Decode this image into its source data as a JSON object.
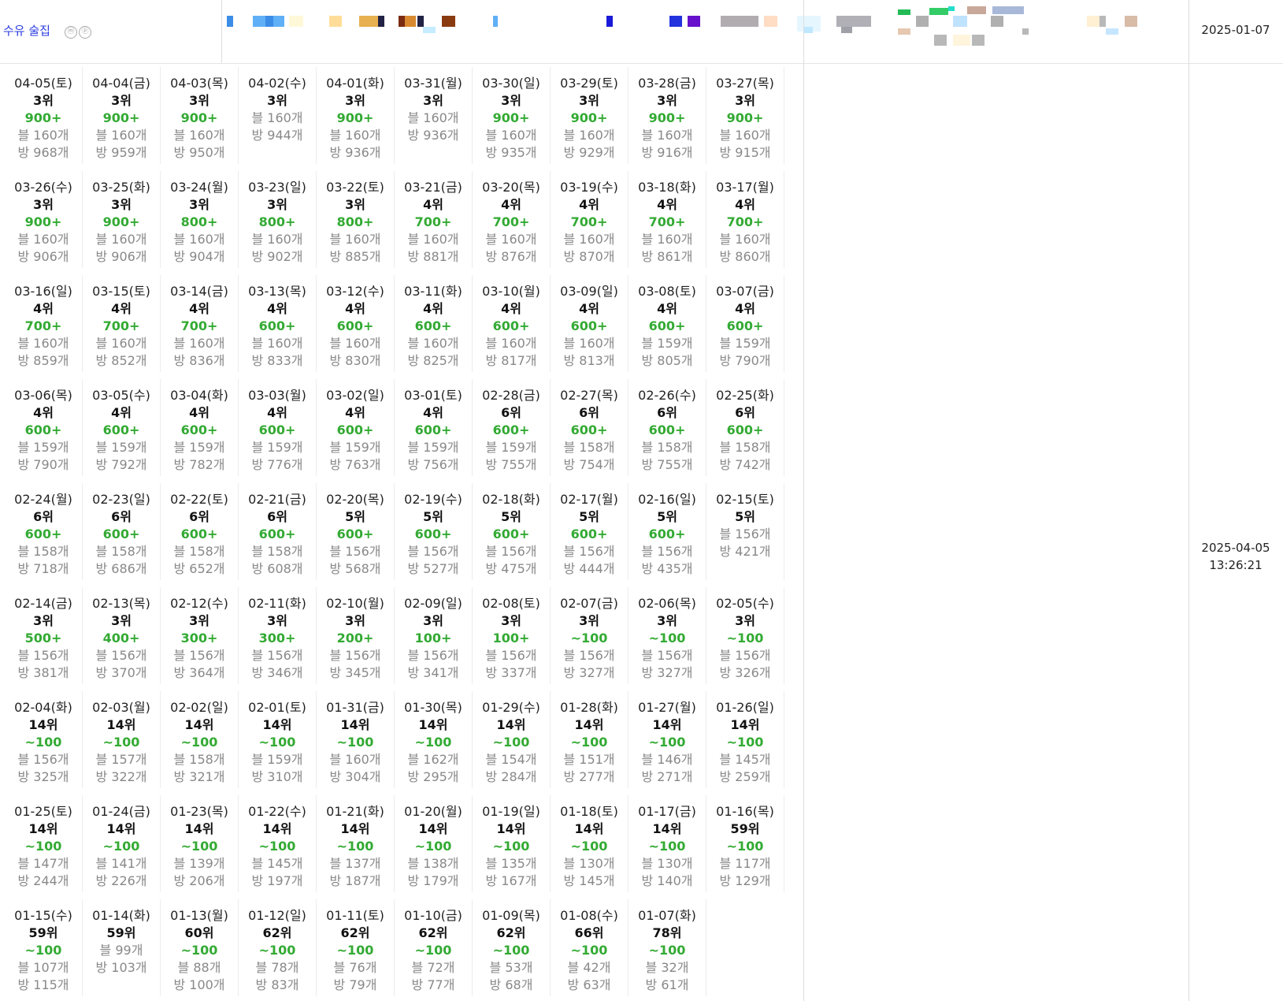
{
  "header": {
    "keyword": "수유 술집",
    "icons": [
      "ⓜ",
      "ⓟ"
    ],
    "start_date": "2025-01-07"
  },
  "updated": {
    "date": "2025-04-05",
    "time": "13:26:21"
  },
  "entries": [
    {
      "d": "04-05(토)",
      "r": "3위",
      "g": "900+",
      "b": "블 160개",
      "m": "방 968개"
    },
    {
      "d": "04-04(금)",
      "r": "3위",
      "g": "900+",
      "b": "블 160개",
      "m": "방 959개"
    },
    {
      "d": "04-03(목)",
      "r": "3위",
      "g": "900+",
      "b": "블 160개",
      "m": "방 950개"
    },
    {
      "d": "04-02(수)",
      "r": "3위",
      "g": "",
      "b": "블 160개",
      "m": "방 944개"
    },
    {
      "d": "04-01(화)",
      "r": "3위",
      "g": "900+",
      "b": "블 160개",
      "m": "방 936개"
    },
    {
      "d": "03-31(월)",
      "r": "3위",
      "g": "",
      "b": "블 160개",
      "m": "방 936개"
    },
    {
      "d": "03-30(일)",
      "r": "3위",
      "g": "900+",
      "b": "블 160개",
      "m": "방 935개"
    },
    {
      "d": "03-29(토)",
      "r": "3위",
      "g": "900+",
      "b": "블 160개",
      "m": "방 929개"
    },
    {
      "d": "03-28(금)",
      "r": "3위",
      "g": "900+",
      "b": "블 160개",
      "m": "방 916개"
    },
    {
      "d": "03-27(목)",
      "r": "3위",
      "g": "900+",
      "b": "블 160개",
      "m": "방 915개"
    },
    {
      "d": "03-26(수)",
      "r": "3위",
      "g": "900+",
      "b": "블 160개",
      "m": "방 906개"
    },
    {
      "d": "03-25(화)",
      "r": "3위",
      "g": "900+",
      "b": "블 160개",
      "m": "방 906개"
    },
    {
      "d": "03-24(월)",
      "r": "3위",
      "g": "800+",
      "b": "블 160개",
      "m": "방 904개"
    },
    {
      "d": "03-23(일)",
      "r": "3위",
      "g": "800+",
      "b": "블 160개",
      "m": "방 902개"
    },
    {
      "d": "03-22(토)",
      "r": "3위",
      "g": "800+",
      "b": "블 160개",
      "m": "방 885개"
    },
    {
      "d": "03-21(금)",
      "r": "4위",
      "g": "700+",
      "b": "블 160개",
      "m": "방 881개"
    },
    {
      "d": "03-20(목)",
      "r": "4위",
      "g": "700+",
      "b": "블 160개",
      "m": "방 876개"
    },
    {
      "d": "03-19(수)",
      "r": "4위",
      "g": "700+",
      "b": "블 160개",
      "m": "방 870개"
    },
    {
      "d": "03-18(화)",
      "r": "4위",
      "g": "700+",
      "b": "블 160개",
      "m": "방 861개"
    },
    {
      "d": "03-17(월)",
      "r": "4위",
      "g": "700+",
      "b": "블 160개",
      "m": "방 860개"
    },
    {
      "d": "03-16(일)",
      "r": "4위",
      "g": "700+",
      "b": "블 160개",
      "m": "방 859개"
    },
    {
      "d": "03-15(토)",
      "r": "4위",
      "g": "700+",
      "b": "블 160개",
      "m": "방 852개"
    },
    {
      "d": "03-14(금)",
      "r": "4위",
      "g": "700+",
      "b": "블 160개",
      "m": "방 836개"
    },
    {
      "d": "03-13(목)",
      "r": "4위",
      "g": "600+",
      "b": "블 160개",
      "m": "방 833개"
    },
    {
      "d": "03-12(수)",
      "r": "4위",
      "g": "600+",
      "b": "블 160개",
      "m": "방 830개"
    },
    {
      "d": "03-11(화)",
      "r": "4위",
      "g": "600+",
      "b": "블 160개",
      "m": "방 825개"
    },
    {
      "d": "03-10(월)",
      "r": "4위",
      "g": "600+",
      "b": "블 160개",
      "m": "방 817개"
    },
    {
      "d": "03-09(일)",
      "r": "4위",
      "g": "600+",
      "b": "블 160개",
      "m": "방 813개"
    },
    {
      "d": "03-08(토)",
      "r": "4위",
      "g": "600+",
      "b": "블 159개",
      "m": "방 805개"
    },
    {
      "d": "03-07(금)",
      "r": "4위",
      "g": "600+",
      "b": "블 159개",
      "m": "방 790개"
    },
    {
      "d": "03-06(목)",
      "r": "4위",
      "g": "600+",
      "b": "블 159개",
      "m": "방 790개"
    },
    {
      "d": "03-05(수)",
      "r": "4위",
      "g": "600+",
      "b": "블 159개",
      "m": "방 792개"
    },
    {
      "d": "03-04(화)",
      "r": "4위",
      "g": "600+",
      "b": "블 159개",
      "m": "방 782개"
    },
    {
      "d": "03-03(월)",
      "r": "4위",
      "g": "600+",
      "b": "블 159개",
      "m": "방 776개"
    },
    {
      "d": "03-02(일)",
      "r": "4위",
      "g": "600+",
      "b": "블 159개",
      "m": "방 763개"
    },
    {
      "d": "03-01(토)",
      "r": "4위",
      "g": "600+",
      "b": "블 159개",
      "m": "방 756개"
    },
    {
      "d": "02-28(금)",
      "r": "6위",
      "g": "600+",
      "b": "블 159개",
      "m": "방 755개"
    },
    {
      "d": "02-27(목)",
      "r": "6위",
      "g": "600+",
      "b": "블 158개",
      "m": "방 754개"
    },
    {
      "d": "02-26(수)",
      "r": "6위",
      "g": "600+",
      "b": "블 158개",
      "m": "방 755개"
    },
    {
      "d": "02-25(화)",
      "r": "6위",
      "g": "600+",
      "b": "블 158개",
      "m": "방 742개"
    },
    {
      "d": "02-24(월)",
      "r": "6위",
      "g": "600+",
      "b": "블 158개",
      "m": "방 718개"
    },
    {
      "d": "02-23(일)",
      "r": "6위",
      "g": "600+",
      "b": "블 158개",
      "m": "방 686개"
    },
    {
      "d": "02-22(토)",
      "r": "6위",
      "g": "600+",
      "b": "블 158개",
      "m": "방 652개"
    },
    {
      "d": "02-21(금)",
      "r": "6위",
      "g": "600+",
      "b": "블 158개",
      "m": "방 608개"
    },
    {
      "d": "02-20(목)",
      "r": "5위",
      "g": "600+",
      "b": "블 156개",
      "m": "방 568개"
    },
    {
      "d": "02-19(수)",
      "r": "5위",
      "g": "600+",
      "b": "블 156개",
      "m": "방 527개"
    },
    {
      "d": "02-18(화)",
      "r": "5위",
      "g": "600+",
      "b": "블 156개",
      "m": "방 475개"
    },
    {
      "d": "02-17(월)",
      "r": "5위",
      "g": "600+",
      "b": "블 156개",
      "m": "방 444개"
    },
    {
      "d": "02-16(일)",
      "r": "5위",
      "g": "600+",
      "b": "블 156개",
      "m": "방 435개"
    },
    {
      "d": "02-15(토)",
      "r": "5위",
      "g": "",
      "b": "블 156개",
      "m": "방 421개"
    },
    {
      "d": "02-14(금)",
      "r": "3위",
      "g": "500+",
      "b": "블 156개",
      "m": "방 381개"
    },
    {
      "d": "02-13(목)",
      "r": "3위",
      "g": "400+",
      "b": "블 156개",
      "m": "방 370개"
    },
    {
      "d": "02-12(수)",
      "r": "3위",
      "g": "300+",
      "b": "블 156개",
      "m": "방 364개"
    },
    {
      "d": "02-11(화)",
      "r": "3위",
      "g": "300+",
      "b": "블 156개",
      "m": "방 346개"
    },
    {
      "d": "02-10(월)",
      "r": "3위",
      "g": "200+",
      "b": "블 156개",
      "m": "방 345개"
    },
    {
      "d": "02-09(일)",
      "r": "3위",
      "g": "100+",
      "b": "블 156개",
      "m": "방 341개"
    },
    {
      "d": "02-08(토)",
      "r": "3위",
      "g": "100+",
      "b": "블 156개",
      "m": "방 337개"
    },
    {
      "d": "02-07(금)",
      "r": "3위",
      "g": "~100",
      "b": "블 156개",
      "m": "방 327개"
    },
    {
      "d": "02-06(목)",
      "r": "3위",
      "g": "~100",
      "b": "블 156개",
      "m": "방 327개"
    },
    {
      "d": "02-05(수)",
      "r": "3위",
      "g": "~100",
      "b": "블 156개",
      "m": "방 326개"
    },
    {
      "d": "02-04(화)",
      "r": "14위",
      "g": "~100",
      "b": "블 156개",
      "m": "방 325개"
    },
    {
      "d": "02-03(월)",
      "r": "14위",
      "g": "~100",
      "b": "블 157개",
      "m": "방 322개"
    },
    {
      "d": "02-02(일)",
      "r": "14위",
      "g": "~100",
      "b": "블 158개",
      "m": "방 321개"
    },
    {
      "d": "02-01(토)",
      "r": "14위",
      "g": "~100",
      "b": "블 159개",
      "m": "방 310개"
    },
    {
      "d": "01-31(금)",
      "r": "14위",
      "g": "~100",
      "b": "블 160개",
      "m": "방 304개"
    },
    {
      "d": "01-30(목)",
      "r": "14위",
      "g": "~100",
      "b": "블 162개",
      "m": "방 295개"
    },
    {
      "d": "01-29(수)",
      "r": "14위",
      "g": "~100",
      "b": "블 154개",
      "m": "방 284개"
    },
    {
      "d": "01-28(화)",
      "r": "14위",
      "g": "~100",
      "b": "블 151개",
      "m": "방 277개"
    },
    {
      "d": "01-27(월)",
      "r": "14위",
      "g": "~100",
      "b": "블 146개",
      "m": "방 271개"
    },
    {
      "d": "01-26(일)",
      "r": "14위",
      "g": "~100",
      "b": "블 145개",
      "m": "방 259개"
    },
    {
      "d": "01-25(토)",
      "r": "14위",
      "g": "~100",
      "b": "블 147개",
      "m": "방 244개"
    },
    {
      "d": "01-24(금)",
      "r": "14위",
      "g": "~100",
      "b": "블 141개",
      "m": "방 226개"
    },
    {
      "d": "01-23(목)",
      "r": "14위",
      "g": "~100",
      "b": "블 139개",
      "m": "방 206개"
    },
    {
      "d": "01-22(수)",
      "r": "14위",
      "g": "~100",
      "b": "블 145개",
      "m": "방 197개"
    },
    {
      "d": "01-21(화)",
      "r": "14위",
      "g": "~100",
      "b": "블 137개",
      "m": "방 187개"
    },
    {
      "d": "01-20(월)",
      "r": "14위",
      "g": "~100",
      "b": "블 138개",
      "m": "방 179개"
    },
    {
      "d": "01-19(일)",
      "r": "14위",
      "g": "~100",
      "b": "블 135개",
      "m": "방 167개"
    },
    {
      "d": "01-18(토)",
      "r": "14위",
      "g": "~100",
      "b": "블 130개",
      "m": "방 145개"
    },
    {
      "d": "01-17(금)",
      "r": "14위",
      "g": "~100",
      "b": "블 130개",
      "m": "방 140개"
    },
    {
      "d": "01-16(목)",
      "r": "59위",
      "g": "~100",
      "b": "블 117개",
      "m": "방 129개"
    },
    {
      "d": "01-15(수)",
      "r": "59위",
      "g": "~100",
      "b": "블 107개",
      "m": "방 115개"
    },
    {
      "d": "01-14(화)",
      "r": "59위",
      "g": "",
      "b": "블 99개",
      "m": "방 103개"
    },
    {
      "d": "01-13(월)",
      "r": "60위",
      "g": "~100",
      "b": "블 88개",
      "m": "방 100개"
    },
    {
      "d": "01-12(일)",
      "r": "62위",
      "g": "~100",
      "b": "블 78개",
      "m": "방 83개"
    },
    {
      "d": "01-11(토)",
      "r": "62위",
      "g": "~100",
      "b": "블 76개",
      "m": "방 79개"
    },
    {
      "d": "01-10(금)",
      "r": "62위",
      "g": "~100",
      "b": "블 72개",
      "m": "방 77개"
    },
    {
      "d": "01-09(목)",
      "r": "62위",
      "g": "~100",
      "b": "블 53개",
      "m": "방 68개"
    },
    {
      "d": "01-08(수)",
      "r": "66위",
      "g": "~100",
      "b": "블 42개",
      "m": "방 63개"
    },
    {
      "d": "01-07(화)",
      "r": "78위",
      "g": "~100",
      "b": "블 32개",
      "m": "방 61개"
    }
  ]
}
